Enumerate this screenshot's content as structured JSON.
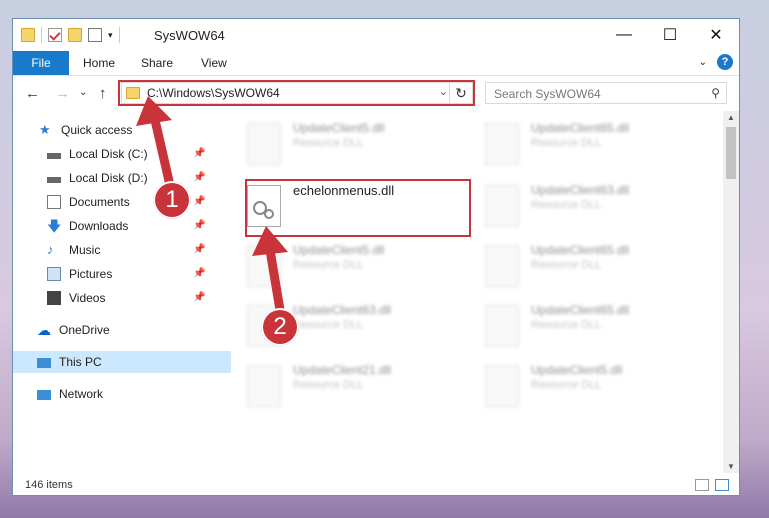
{
  "window": {
    "title": "SysWOW64",
    "controls": {
      "minimize": "—",
      "maximize": "☐",
      "close": "✕"
    }
  },
  "ribbon": {
    "tabs": [
      "File",
      "Home",
      "Share",
      "View"
    ],
    "help": "?"
  },
  "navigation": {
    "back": "←",
    "forward": "→",
    "recent": "⌄",
    "up": "↑",
    "address": "C:\\Windows\\SysWOW64",
    "dropdown": "⌄",
    "refresh": "↻",
    "search_placeholder": "Search SysWOW64"
  },
  "sidebar": {
    "items": [
      {
        "label": "Quick access",
        "icon": "star-icon",
        "pinned": false
      },
      {
        "label": "Local Disk (C:)",
        "icon": "drive-icon",
        "pinned": true
      },
      {
        "label": "Local Disk (D:)",
        "icon": "drive-icon",
        "pinned": true
      },
      {
        "label": "Documents",
        "icon": "documents-icon",
        "pinned": true
      },
      {
        "label": "Downloads",
        "icon": "download-icon",
        "pinned": true
      },
      {
        "label": "Music",
        "icon": "music-icon",
        "pinned": true
      },
      {
        "label": "Pictures",
        "icon": "pictures-icon",
        "pinned": true
      },
      {
        "label": "Videos",
        "icon": "videos-icon",
        "pinned": true
      },
      {
        "label": "OneDrive",
        "icon": "cloud-icon",
        "pinned": false
      },
      {
        "label": "This PC",
        "icon": "computer-icon",
        "pinned": false,
        "selected": true
      },
      {
        "label": "Network",
        "icon": "network-icon",
        "pinned": false
      }
    ]
  },
  "files": {
    "focused": {
      "name": "echelonmenus.dll"
    },
    "blurred": [
      {
        "name": "UpdateClient5.dll",
        "type": "Resource DLL"
      },
      {
        "name": "UpdateClient65.dll",
        "type": "Resource DLL"
      },
      {
        "name": "UpdateClient63.dll",
        "type": "Resource DLL"
      },
      {
        "name": "UpdateClient5.dll",
        "type": "Resource DLL"
      },
      {
        "name": "UpdateClient65.dll",
        "type": "Resource DLL"
      },
      {
        "name": "UpdateClient63.dll",
        "type": "Resource DLL"
      },
      {
        "name": "UpdateClient65.dll",
        "type": "Resource DLL"
      },
      {
        "name": "UpdateClient21.dll",
        "type": "Resource DLL"
      },
      {
        "name": "UpdateClient5.dll",
        "type": "Resource DLL"
      }
    ]
  },
  "status": {
    "item_count": "146 items"
  },
  "annotations": {
    "step1": "1",
    "step2": "2"
  },
  "colors": {
    "accent": "#1979ca",
    "annotation": "#c8343a"
  }
}
